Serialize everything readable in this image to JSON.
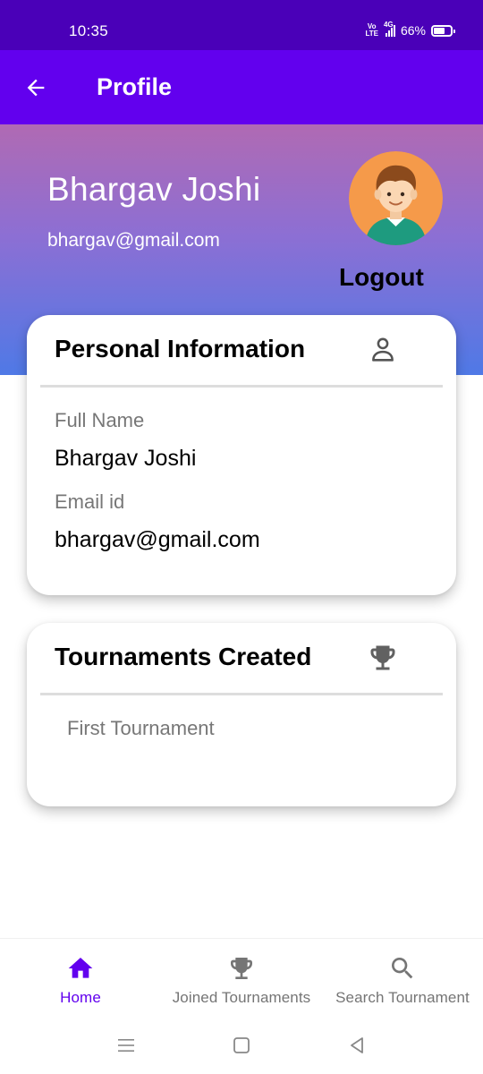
{
  "status_bar": {
    "time": "10:35",
    "network_type": "4G",
    "volte": "Vo LTE",
    "battery": "66%",
    "battery_level": 0.66
  },
  "app_bar": {
    "title": "Profile",
    "back_icon": "arrow-left-icon",
    "color": "#6200ee"
  },
  "header": {
    "name": "Bhargav Joshi",
    "email": "bhargav@gmail.com",
    "logout_label": "Logout",
    "avatar_icon": "avatar-boy-icon",
    "gradient": [
      "#b06ab3",
      "#4f79e6"
    ]
  },
  "personal_info": {
    "title": "Personal Information",
    "icon": "person-icon",
    "fields": [
      {
        "label": "Full Name",
        "value": "Bhargav Joshi"
      },
      {
        "label": "Email id",
        "value": "bhargav@gmail.com"
      }
    ]
  },
  "tournaments_created": {
    "title": "Tournaments Created",
    "icon": "trophy-icon",
    "items": [
      "First Tournament"
    ]
  },
  "bottom_nav": {
    "items": [
      {
        "label": "Home",
        "icon": "home-icon",
        "active": true
      },
      {
        "label": "Joined Tournaments",
        "icon": "trophy-icon",
        "active": false
      },
      {
        "label": "Search Tournament",
        "icon": "search-icon",
        "active": false
      }
    ],
    "active_color": "#6200ee"
  },
  "system_nav": {
    "icons": [
      "menu-icon",
      "home-square-icon",
      "back-triangle-icon"
    ]
  }
}
